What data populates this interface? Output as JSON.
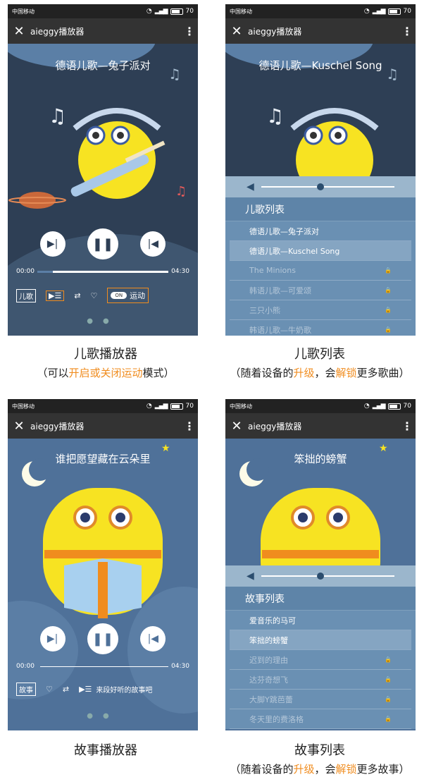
{
  "status": {
    "carrier": "中国移动",
    "battery": "70"
  },
  "app": {
    "title": "aieggy播放器",
    "close": "✕",
    "more": "⋮"
  },
  "panels": [
    {
      "song_title": "德语儿歌—兔子派对",
      "time_start": "00:00",
      "time_end": "04:30",
      "progress": 0.12,
      "tag": "儿歌",
      "toggle_on": "ON",
      "toggle_label": "运动"
    },
    {
      "song_title": "德语儿歌—Kuschel Song",
      "list_title": "儿歌列表",
      "volume": 0.42,
      "items": [
        {
          "label": "德语儿歌—兔子派对",
          "state": "normal"
        },
        {
          "label": "德语儿歌—Kuschel Song",
          "state": "selected"
        },
        {
          "label": "The Minions",
          "state": "locked"
        },
        {
          "label": "韩语儿歌—可爱颂",
          "state": "locked"
        },
        {
          "label": "三只小熊",
          "state": "locked"
        },
        {
          "label": "韩语儿歌—牛奶歌",
          "state": "locked"
        }
      ]
    },
    {
      "song_title": "谁把愿望藏在云朵里",
      "time_start": "00:00",
      "time_end": "04:30",
      "progress": 0.02,
      "tag": "故事",
      "cta": "来段好听的故事吧"
    },
    {
      "song_title": "笨拙的螃蟹",
      "list_title": "故事列表",
      "volume": 0.42,
      "items": [
        {
          "label": "爱音乐的马可",
          "state": "normal"
        },
        {
          "label": "笨拙的螃蟹",
          "state": "selected"
        },
        {
          "label": "迟到的理由",
          "state": "locked"
        },
        {
          "label": "达芬奇想飞",
          "state": "locked"
        },
        {
          "label": "大脚Y跳芭蕾",
          "state": "locked"
        },
        {
          "label": "冬天里的费洛格",
          "state": "locked"
        }
      ]
    }
  ],
  "captions": {
    "c1": {
      "main": "儿歌播放器",
      "sub_pre": "（可以",
      "sub_hl": "开启或关闭运动",
      "sub_post": "模式）"
    },
    "c2": {
      "main": "儿歌列表",
      "sub_pre": "（随着设备的",
      "sub_hl1": "升级",
      "sub_mid": "，会",
      "sub_hl2": "解锁",
      "sub_post": "更多歌曲）"
    },
    "c3": {
      "main": "故事播放器"
    },
    "c4": {
      "main": "故事列表",
      "sub_pre": "（随着设备的",
      "sub_hl1": "升级",
      "sub_mid": "，会",
      "sub_hl2": "解锁",
      "sub_post": "更多故事）"
    }
  },
  "colors": {
    "night_bg": "#2e3f55",
    "story_bg": "#4f7199",
    "accent": "#f08c1e",
    "character": "#f7e322"
  }
}
